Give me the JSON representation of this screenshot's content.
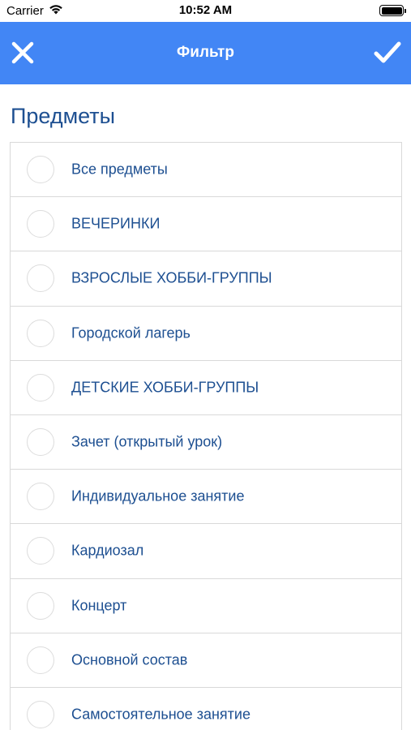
{
  "status_bar": {
    "carrier": "Carrier",
    "time": "10:52 AM"
  },
  "nav": {
    "title": "Фильтр",
    "close_icon": "close-icon",
    "confirm_icon": "checkmark-icon",
    "background": "#4286f5"
  },
  "section": {
    "title": "Предметы"
  },
  "items": [
    {
      "label": "Все предметы"
    },
    {
      "label": "ВЕЧЕРИНКИ"
    },
    {
      "label": "ВЗРОСЛЫЕ ХОББИ-ГРУППЫ"
    },
    {
      "label": "Городской лагерь"
    },
    {
      "label": "ДЕТСКИЕ ХОББИ-ГРУППЫ"
    },
    {
      "label": "Зачет (открытый урок)"
    },
    {
      "label": "Индивидуальное занятие"
    },
    {
      "label": "Кардиозал"
    },
    {
      "label": "Концерт"
    },
    {
      "label": "Основной состав"
    },
    {
      "label": "Самостоятельное занятие"
    }
  ],
  "colors": {
    "accent": "#4286f5",
    "text": "#1d4f91",
    "divider": "#d9d9d9"
  }
}
